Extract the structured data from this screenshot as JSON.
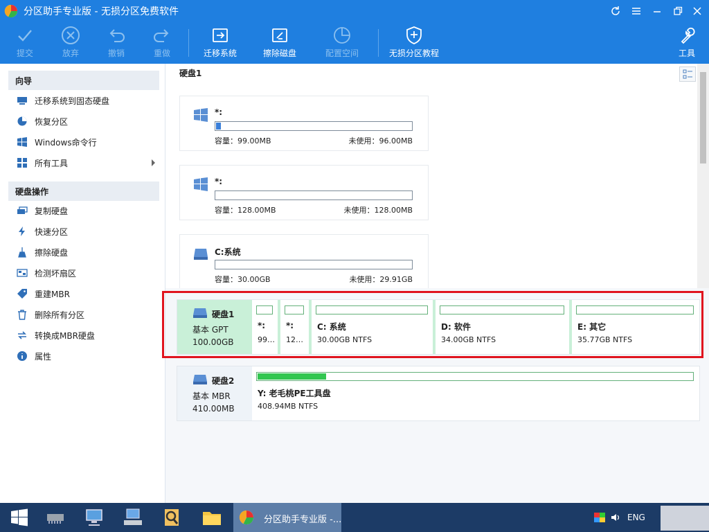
{
  "window": {
    "title": "分区助手专业版 - 无损分区免费软件"
  },
  "toolbar": {
    "commit": "提交",
    "discard": "放弃",
    "undo": "撤销",
    "redo": "重做",
    "migrate": "迁移系统",
    "wipe": "擦除磁盘",
    "allocate": "配置空间",
    "tutorial": "无损分区教程",
    "tools": "工具"
  },
  "sidebar": {
    "wizard_title": "向导",
    "wizard_items": [
      {
        "label": "迁移系统到固态硬盘",
        "icon": "ssd-migrate-icon"
      },
      {
        "label": "恢复分区",
        "icon": "recover-icon"
      },
      {
        "label": "Windows命令行",
        "icon": "windows-icon"
      },
      {
        "label": "所有工具",
        "icon": "tools-grid-icon"
      }
    ],
    "disk_ops_title": "硬盘操作",
    "disk_items": [
      {
        "label": "复制硬盘",
        "icon": "copy-disk-icon"
      },
      {
        "label": "快速分区",
        "icon": "lightning-icon"
      },
      {
        "label": "擦除硬盘",
        "icon": "broom-icon"
      },
      {
        "label": "检测坏扇区",
        "icon": "scan-icon"
      },
      {
        "label": "重建MBR",
        "icon": "tag-icon"
      },
      {
        "label": "删除所有分区",
        "icon": "trash-icon"
      },
      {
        "label": "转换成MBR硬盘",
        "icon": "convert-icon"
      },
      {
        "label": "属性",
        "icon": "info-icon"
      }
    ]
  },
  "disk_view": {
    "title": "硬盘1",
    "partitions": [
      {
        "name": "*:",
        "capacity": "容量：99.00MB",
        "unused": "未使用：96.00MB",
        "used_fraction": 0.03,
        "icon": "windows-icon"
      },
      {
        "name": "*:",
        "capacity": "容量：128.00MB",
        "unused": "未使用：128.00MB",
        "used_fraction": 0.0,
        "icon": "windows-icon"
      },
      {
        "name": "C:系统",
        "capacity": "容量：30.00GB",
        "unused": "未使用：29.91GB",
        "used_fraction": 0.003,
        "icon": "drive-icon"
      }
    ]
  },
  "disks": [
    {
      "name": "硬盘1",
      "type": "基本 GPT",
      "size": "100.00GB",
      "partitions": [
        {
          "label": "*:",
          "info": "99…",
          "used_fraction": 0.0
        },
        {
          "label": "*:",
          "info": "12…",
          "used_fraction": 0.0
        },
        {
          "label": "C: 系统",
          "info": "30.00GB NTFS",
          "used_fraction": 0.0
        },
        {
          "label": "D: 软件",
          "info": "34.00GB NTFS",
          "used_fraction": 0.0
        },
        {
          "label": "E: 其它",
          "info": "35.77GB NTFS",
          "used_fraction": 0.0
        }
      ]
    },
    {
      "name": "硬盘2",
      "type": "基本 MBR",
      "size": "410.00MB",
      "partitions": [
        {
          "label": "Y: 老毛桃PE工具盘",
          "info": "408.94MB NTFS",
          "used_fraction": 0.16
        }
      ]
    }
  ],
  "taskbar": {
    "active_app": "分区助手专业版 -...",
    "language": "ENG"
  },
  "colors": {
    "accent": "#1f7fe0",
    "selected_disk": "#c9f0d8",
    "used_bar": "#32c650",
    "highlight": "#e0141e",
    "taskbar": "#1c3b66"
  }
}
